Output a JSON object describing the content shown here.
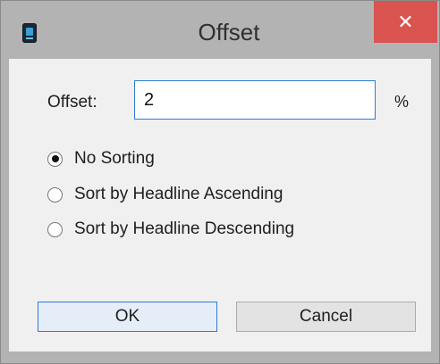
{
  "window": {
    "title": "Offset",
    "icon": "app-icon",
    "close_icon": "close-icon",
    "close_glyph": "✕"
  },
  "form": {
    "offset_label": "Offset:",
    "offset_value": "2",
    "unit": "%"
  },
  "sorting": {
    "selected": "No Sorting",
    "options": [
      {
        "label": "No Sorting",
        "selected": true
      },
      {
        "label": "Sort by Headline Ascending",
        "selected": false
      },
      {
        "label": "Sort by Headline Descending",
        "selected": false
      }
    ]
  },
  "buttons": {
    "ok": "OK",
    "cancel": "Cancel"
  },
  "colors": {
    "accent": "#2d7bd3",
    "close": "#d9534f"
  }
}
